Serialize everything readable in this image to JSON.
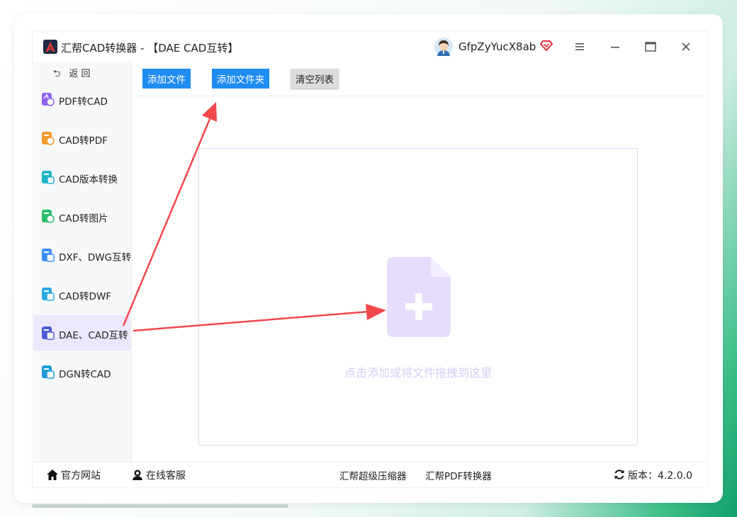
{
  "app": {
    "title": "汇帮CAD转换器 - 【DAE CAD互转】",
    "username": "GfpZyYucX8ab"
  },
  "sidebar": {
    "back_label": "返 回",
    "items": [
      {
        "label": "PDF转CAD",
        "icon": "pdf-to-cad-icon"
      },
      {
        "label": "CAD转PDF",
        "icon": "cad-to-pdf-icon"
      },
      {
        "label": "CAD版本转换",
        "icon": "cad-version-icon"
      },
      {
        "label": "CAD转图片",
        "icon": "cad-to-image-icon"
      },
      {
        "label": "DXF、DWG互转",
        "icon": "dxf-dwg-icon"
      },
      {
        "label": "CAD转DWF",
        "icon": "cad-to-dwf-icon"
      },
      {
        "label": "DAE、CAD互转",
        "icon": "dae-cad-icon",
        "active": true
      },
      {
        "label": "DGN转CAD",
        "icon": "dgn-to-cad-icon"
      }
    ]
  },
  "toolbar": {
    "add_file": "添加文件",
    "add_folder": "添加文件夹",
    "clear_list": "清空列表"
  },
  "dropzone": {
    "hint": "点击添加或将文件拖拽到这里"
  },
  "footer": {
    "website": "官方网站",
    "support": "在线客服",
    "compressor": "汇帮超级压缩器",
    "pdf_converter": "汇帮PDF转换器",
    "version_label": "版本：4.2.0.0"
  },
  "colors": {
    "accent_blue": "#1f8cf2",
    "active_item": "#ece7fd",
    "file_icon": "#e6dcfb",
    "arrow_red": "#f2484c",
    "brand_green": "#12a06a"
  }
}
